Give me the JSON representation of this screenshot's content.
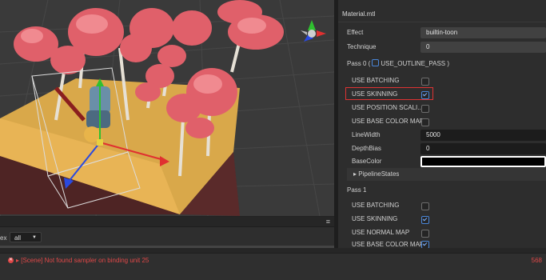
{
  "scene": {
    "filter_label": "ex",
    "filter_value": "all",
    "filter_arrow": "▼",
    "menu_icon": "≡"
  },
  "inspector": {
    "title": "Material.mtl",
    "effect_label": "Effect",
    "effect_value": "builtin-toon",
    "technique_label": "Technique",
    "technique_value": "0",
    "pass0": {
      "header_prefix": "Pass 0 (",
      "header_suffix": "USE_OUTLINE_PASS )",
      "use_batching": "USE BATCHING",
      "use_skinning": "USE SKINNING",
      "use_position_scaling": "USE POSITION SCALI...",
      "use_base_color_map": "USE BASE COLOR MAP",
      "linewidth_label": "LineWidth",
      "linewidth_value": "5000",
      "depthbias_label": "DepthBias",
      "depthbias_value": "0",
      "basecolor_label": "BaseColor",
      "pipeline_states": "PipelineStates"
    },
    "pass1": {
      "header": "Pass 1",
      "use_batching": "USE BATCHING",
      "use_skinning": "USE SKINNING",
      "use_normal_map": "USE NORMAL MAP",
      "use_base_color_map": "USE BASE COLOR MAP"
    }
  },
  "console": {
    "message": "▸ [Scene] Not found sampler on binding unit 25",
    "count": "568"
  },
  "colors": {
    "error": "#e04848",
    "accent": "#4a86d8",
    "highlight": "#dd3333"
  }
}
